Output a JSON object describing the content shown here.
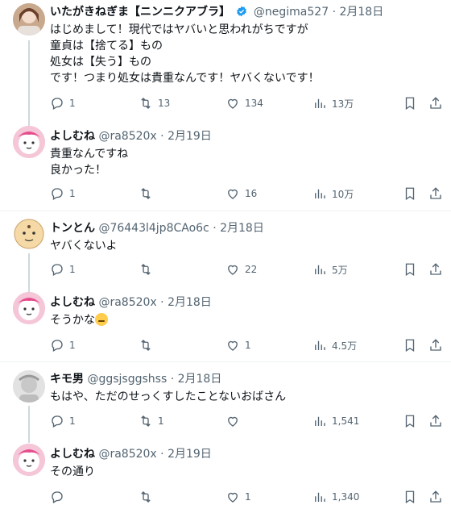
{
  "tweets": [
    {
      "name": "いたがきねぎま【ニンニクアブラ】",
      "handle": "@negima527",
      "date": "2月18日",
      "verified": true,
      "lines": [
        "はじめまして！現代ではヤバいと思われがちですが",
        "童貞は【捨てる】もの",
        "処女は【失う】もの",
        "です！つまり処女は貴重なんです！ヤバくないです！"
      ],
      "replies": "1",
      "retweets": "13",
      "likes": "134",
      "views": "13万"
    },
    {
      "name": "よしむね",
      "handle": "@ra8520x",
      "date": "2月19日",
      "lines": [
        "貴重なんですね",
        "良かった！"
      ],
      "replies": "1",
      "retweets": "",
      "likes": "16",
      "views": "10万"
    },
    {
      "name": "トンとん",
      "handle": "@76443l4jp8CAo6c",
      "date": "2月18日",
      "lines": [
        "ヤバくないよ"
      ],
      "replies": "1",
      "retweets": "",
      "likes": "22",
      "views": "5万"
    },
    {
      "name": "よしむね",
      "handle": "@ra8520x",
      "date": "2月18日",
      "lines": [
        "そうかな"
      ],
      "replies": "1",
      "retweets": "",
      "likes": "1",
      "views": "4.5万"
    },
    {
      "name": "キモ男",
      "handle": "@ggsjsggshss",
      "date": "2月18日",
      "lines": [
        "もはや、ただのせっくすしたことないおばさん"
      ],
      "replies": "1",
      "retweets": "1",
      "likes": "",
      "views": "1,541"
    },
    {
      "name": "よしむね",
      "handle": "@ra8520x",
      "date": "2月19日",
      "lines": [
        "その通り"
      ],
      "replies": "",
      "retweets": "",
      "likes": "1",
      "views": "1,340"
    }
  ],
  "colors": {
    "verified": "#1d9bf0",
    "muted": "#536471",
    "line": "#cfd9de"
  },
  "icons": {
    "reply": "reply-icon",
    "retweet": "retweet-icon",
    "like": "heart-icon",
    "views": "views-icon",
    "bookmark": "bookmark-icon",
    "share": "share-icon"
  }
}
